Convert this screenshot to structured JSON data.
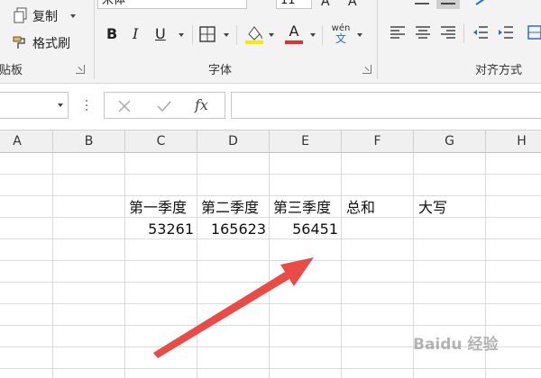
{
  "ribbon": {
    "clipboard": {
      "copy_label": "复制",
      "format_painter_label": "格式刷",
      "group_label": "剪贴板"
    },
    "font": {
      "font_name": "宋体",
      "font_size": "11",
      "group_label": "字体",
      "bold": "B",
      "italic": "I",
      "underline": "U",
      "wen_top": "wén",
      "wen_bottom": "文",
      "font_color_hex": "#e03030",
      "fill_color_hex": "#ffe600"
    },
    "alignment": {
      "group_label": "对齐方式"
    }
  },
  "formula_bar": {
    "name_box_value": "",
    "formula_value": "",
    "fx_label": "fx"
  },
  "columns": [
    "A",
    "B",
    "C",
    "D",
    "E",
    "F",
    "G",
    "H"
  ],
  "sheet": {
    "row1": {
      "c": "第一季度",
      "d": "第二季度",
      "e": "第三季度",
      "f": "总和",
      "g": "大写"
    },
    "row2": {
      "c": "53261",
      "d": "165623",
      "e": "56451"
    }
  },
  "annotation": {
    "arrow_color": "#e8413c"
  },
  "watermark": "Baidu 经验"
}
